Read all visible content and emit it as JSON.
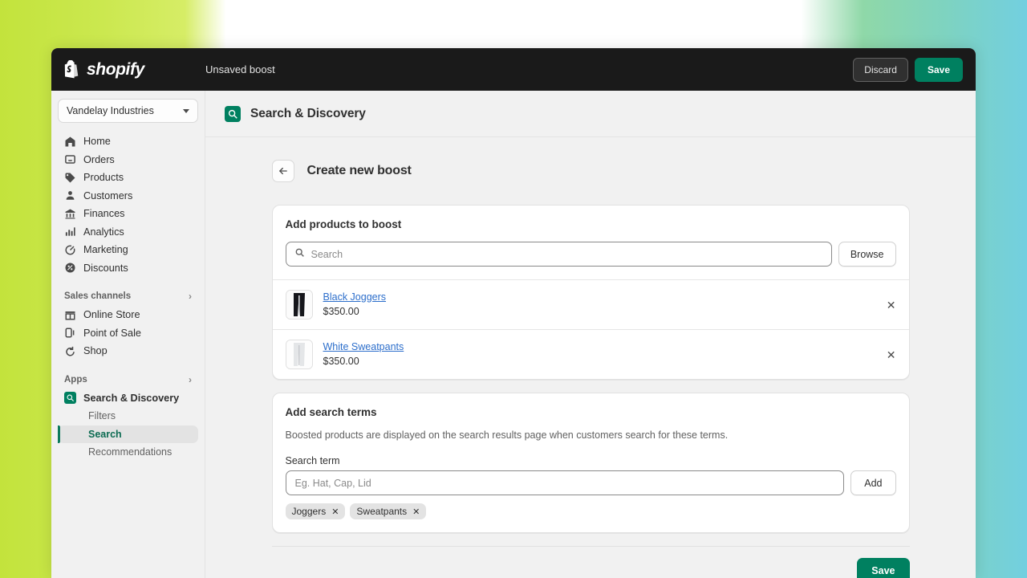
{
  "topbar": {
    "brand": "shopify",
    "title": "Unsaved boost",
    "discard_label": "Discard",
    "save_label": "Save"
  },
  "sidebar": {
    "store": "Vandelay Industries",
    "nav": [
      {
        "label": "Home",
        "icon": "home-icon"
      },
      {
        "label": "Orders",
        "icon": "orders-icon"
      },
      {
        "label": "Products",
        "icon": "products-tag-icon"
      },
      {
        "label": "Customers",
        "icon": "customers-person-icon"
      },
      {
        "label": "Finances",
        "icon": "finances-bank-icon"
      },
      {
        "label": "Analytics",
        "icon": "analytics-bars-icon"
      },
      {
        "label": "Marketing",
        "icon": "marketing-target-icon"
      },
      {
        "label": "Discounts",
        "icon": "discounts-badge-icon"
      }
    ],
    "sales_channels_heading": "Sales channels",
    "sales_channels": [
      {
        "label": "Online Store",
        "icon": "store-icon"
      },
      {
        "label": "Point of Sale",
        "icon": "pos-icon"
      },
      {
        "label": "Shop",
        "icon": "shop-icon"
      }
    ],
    "apps_heading": "Apps",
    "apps": [
      {
        "label": "Search & Discovery",
        "icon": "search-discovery-app-icon"
      }
    ],
    "app_subitems": [
      {
        "label": "Filters",
        "active": false
      },
      {
        "label": "Search",
        "active": true
      },
      {
        "label": "Recommendations",
        "active": false
      }
    ]
  },
  "main": {
    "app_header_title": "Search & Discovery",
    "page_title": "Create new boost",
    "products_card": {
      "title": "Add products to boost",
      "search_placeholder": "Search",
      "search_value": "",
      "browse_label": "Browse",
      "products": [
        {
          "name": "Black Joggers",
          "price": "$350.00",
          "thumb": "black-joggers"
        },
        {
          "name": "White Sweatpants",
          "price": "$350.00",
          "thumb": "white-sweatpants"
        }
      ]
    },
    "terms_card": {
      "title": "Add search terms",
      "help": "Boosted products are displayed on the search results page when customers search for these terms.",
      "field_label": "Search term",
      "input_placeholder": "Eg. Hat, Cap, Lid",
      "input_value": "",
      "add_label": "Add",
      "tags": [
        "Joggers",
        "Sweatpants"
      ]
    },
    "save_label": "Save"
  },
  "colors": {
    "brand_green": "#008060",
    "accent_green": "#0c7a5c",
    "link_blue": "#2c6ecb",
    "topbar_black": "#1a1a1a"
  }
}
